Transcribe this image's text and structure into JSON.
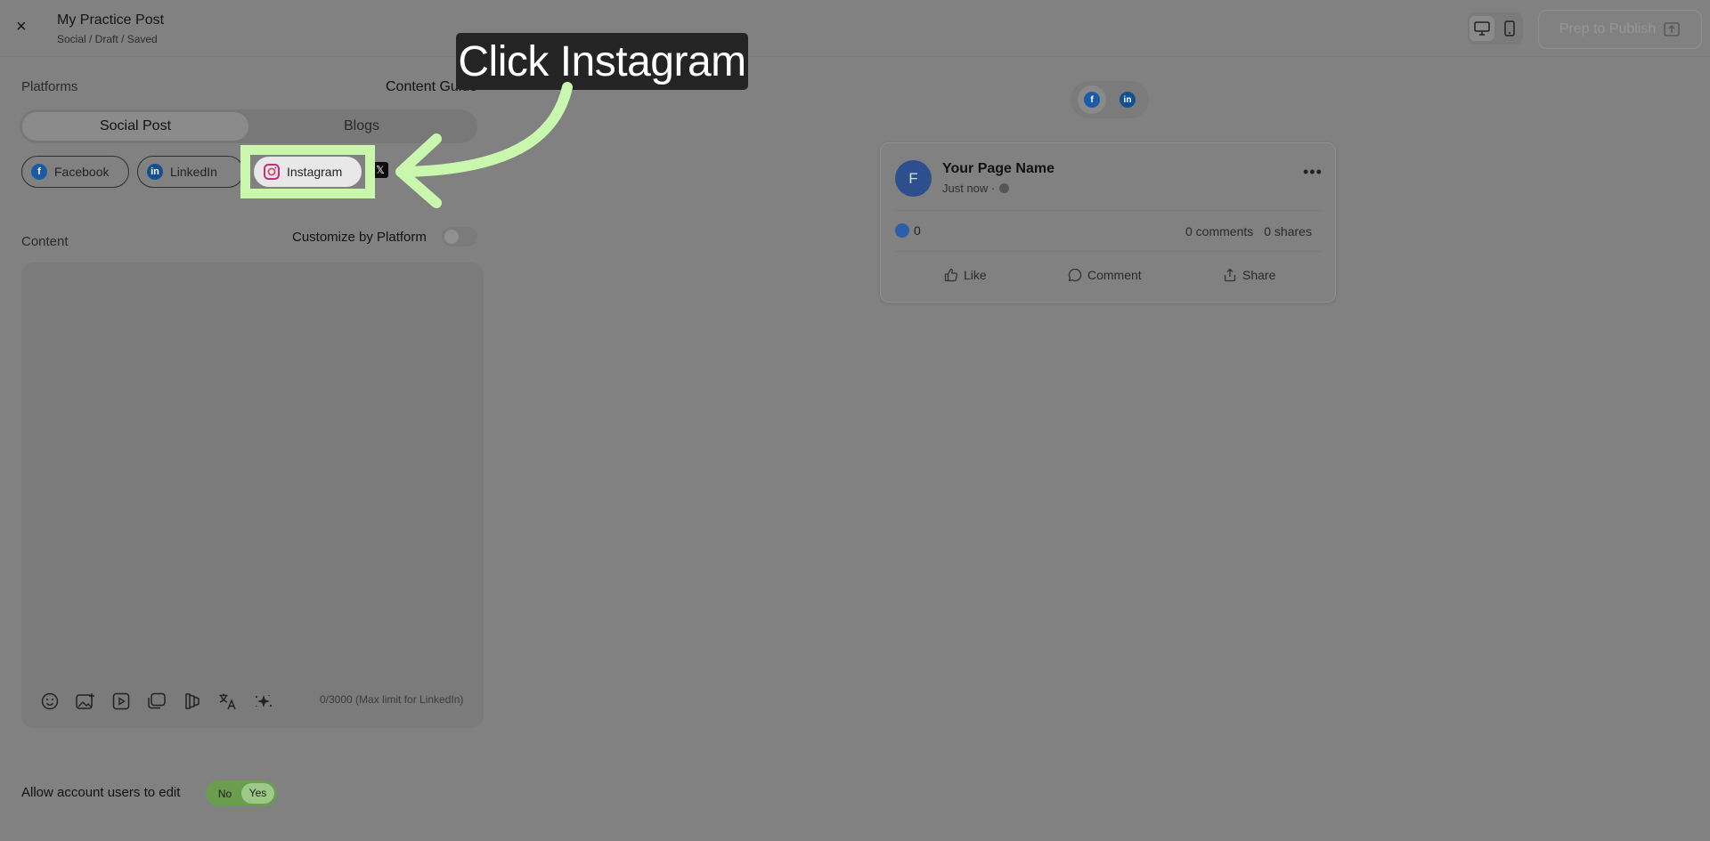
{
  "header": {
    "close_label": "×",
    "title": "My Practice Post",
    "breadcrumb": "Social / Draft / Saved",
    "prep_to_publish": "Prep to Publish"
  },
  "left_panel": {
    "platforms_label": "Platforms",
    "content_guide": "Content Guide",
    "tabs": [
      {
        "label": "Social Post",
        "active": true
      },
      {
        "label": "Blogs",
        "active": false
      }
    ],
    "platform_chips": [
      {
        "label": "Facebook"
      },
      {
        "label": "LinkedIn"
      },
      {
        "label": "Instagram"
      }
    ],
    "x_chip": "𝕏",
    "content_label": "Content",
    "customize_label": "Customize by Platform",
    "char_count": "0/3000 (Max limit for LinkedIn)",
    "allow_edit_label": "Allow account users to edit",
    "allow_edit_no": "No",
    "allow_edit_yes": "Yes"
  },
  "tooltip": {
    "text": "Click Instagram"
  },
  "preview": {
    "avatar_letter": "F",
    "page_name": "Your Page Name",
    "post_time": "Just now ·",
    "reaction_count": "0",
    "comments": "0 comments",
    "shares": "0 shares",
    "actions": [
      "Like",
      "Comment",
      "Share"
    ]
  },
  "colors": {
    "highlight": "#c9f7ae",
    "overlay": "#808180",
    "tooltip_bg": "#242424"
  }
}
